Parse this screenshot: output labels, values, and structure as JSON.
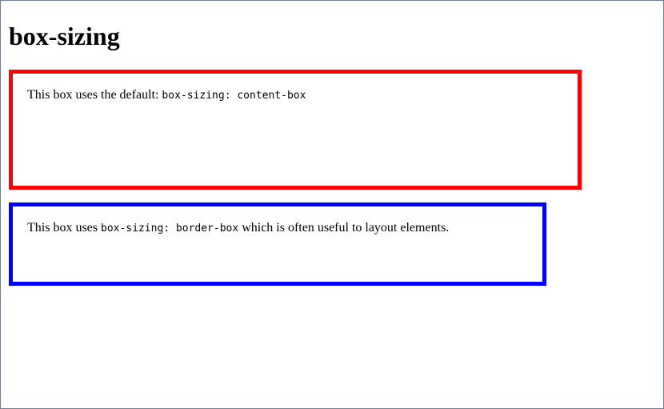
{
  "page": {
    "title": "box-sizing"
  },
  "colors": {
    "content_box_border": "#ff0000",
    "border_box_border": "#0000ff"
  },
  "content_box": {
    "text_before": "This box uses the default: ",
    "code": "box-sizing: content-box"
  },
  "border_box": {
    "text_before": "This box uses ",
    "code": "box-sizing: border-box",
    "text_after": " which is often useful to layout elements."
  }
}
